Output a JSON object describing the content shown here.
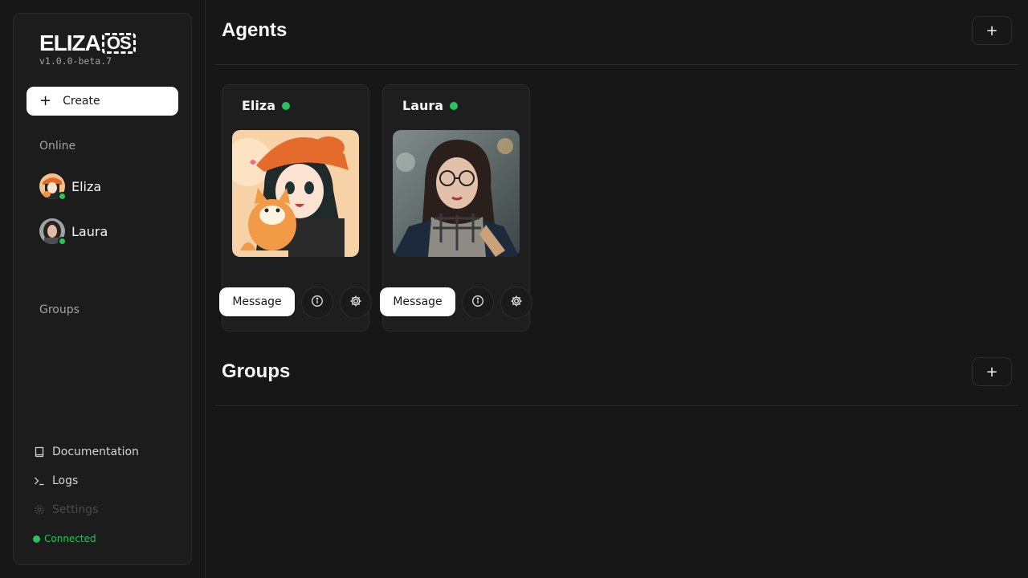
{
  "sidebar": {
    "logo_text": "ELIZA",
    "logo_os": "OS",
    "version": "v1.0.0-beta.7",
    "create_label": "Create",
    "online_label": "Online",
    "agents": [
      {
        "name": "Eliza",
        "status": "online"
      },
      {
        "name": "Laura",
        "status": "online"
      }
    ],
    "groups_label": "Groups",
    "footer": [
      {
        "label": "Documentation",
        "icon": "book-icon"
      },
      {
        "label": "Logs",
        "icon": "terminal-icon"
      },
      {
        "label": "Settings",
        "icon": "gear-icon",
        "disabled": true
      }
    ],
    "connection_status": "Connected"
  },
  "main": {
    "agents_title": "Agents",
    "groups_title": "Groups",
    "add_icon": "plus-icon",
    "cards": [
      {
        "name": "Eliza",
        "message_label": "Message"
      },
      {
        "name": "Laura",
        "message_label": "Message"
      }
    ]
  },
  "colors": {
    "background": "#171717",
    "panel": "#1c1c1c",
    "online": "#22c55e",
    "button": "#ffffff"
  }
}
